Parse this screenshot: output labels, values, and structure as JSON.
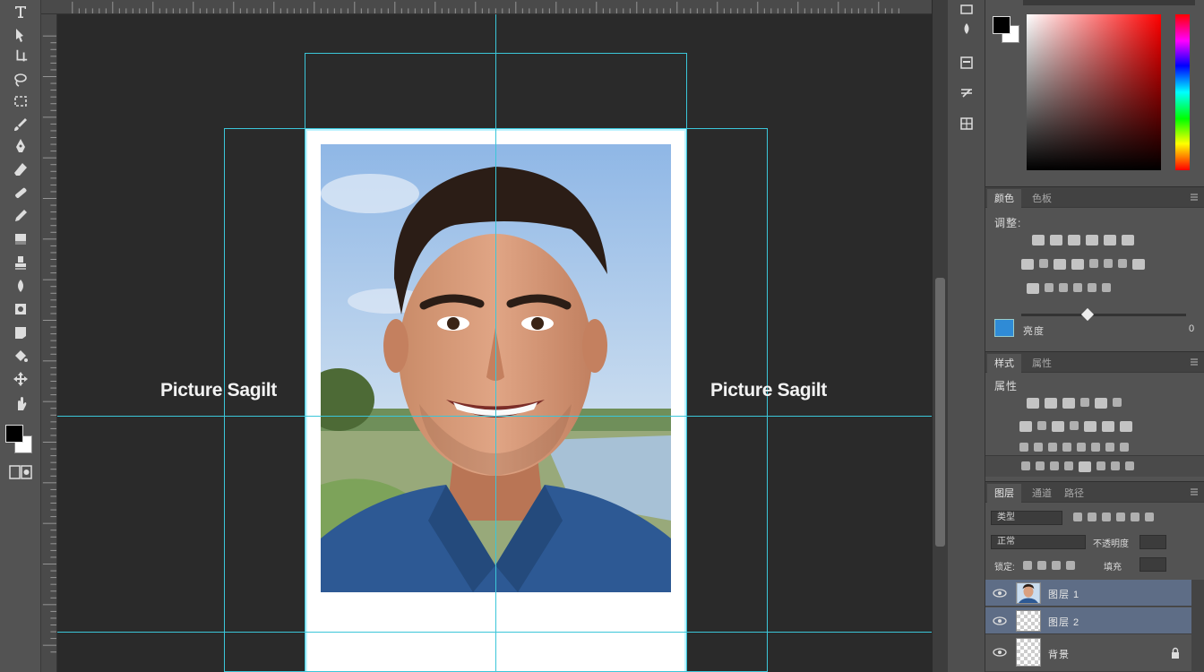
{
  "canvas": {
    "label_left": "Picture Sagilt",
    "label_right": "Picture Sagilt"
  },
  "tools": [
    "type-icon",
    "path-select-icon",
    "crop-icon",
    "lasso-icon",
    "rect-marquee-icon",
    "brush-icon",
    "pen-icon",
    "eraser-icon",
    "spot-heal-icon",
    "pencil-icon",
    "gradient-icon",
    "stamp-icon",
    "blur-icon",
    "dodge-icon",
    "shape-icon",
    "bucket-icon",
    "move-icon",
    "hand-icon"
  ],
  "colors": {
    "guide": "#3bc6d9",
    "foreground": "#000000",
    "background": "#ffffff",
    "selected_layer": "#5e6d86"
  },
  "panels": {
    "adjust_tabs": [
      "颜色",
      "色板"
    ],
    "adjust_header": "调整:",
    "styles_tabs": [
      "样式",
      "属性"
    ],
    "styles_header": "属性",
    "layers_tabs": [
      "图层",
      "通道",
      "路径"
    ],
    "layers_kind": "类型",
    "layers_mode": "正常",
    "opacity_label": "不透明度",
    "fill_label": "填充",
    "lock_label": "锁定:",
    "adjust_slider_label": "亮度",
    "adjust_slider_value": "0"
  },
  "layers": [
    {
      "name": "图层 1",
      "selected": true,
      "thumb": "photo"
    },
    {
      "name": "图层 2",
      "selected": true,
      "thumb": "transparent"
    },
    {
      "name": "背景",
      "selected": false,
      "thumb": "transparent",
      "locked": true
    }
  ]
}
